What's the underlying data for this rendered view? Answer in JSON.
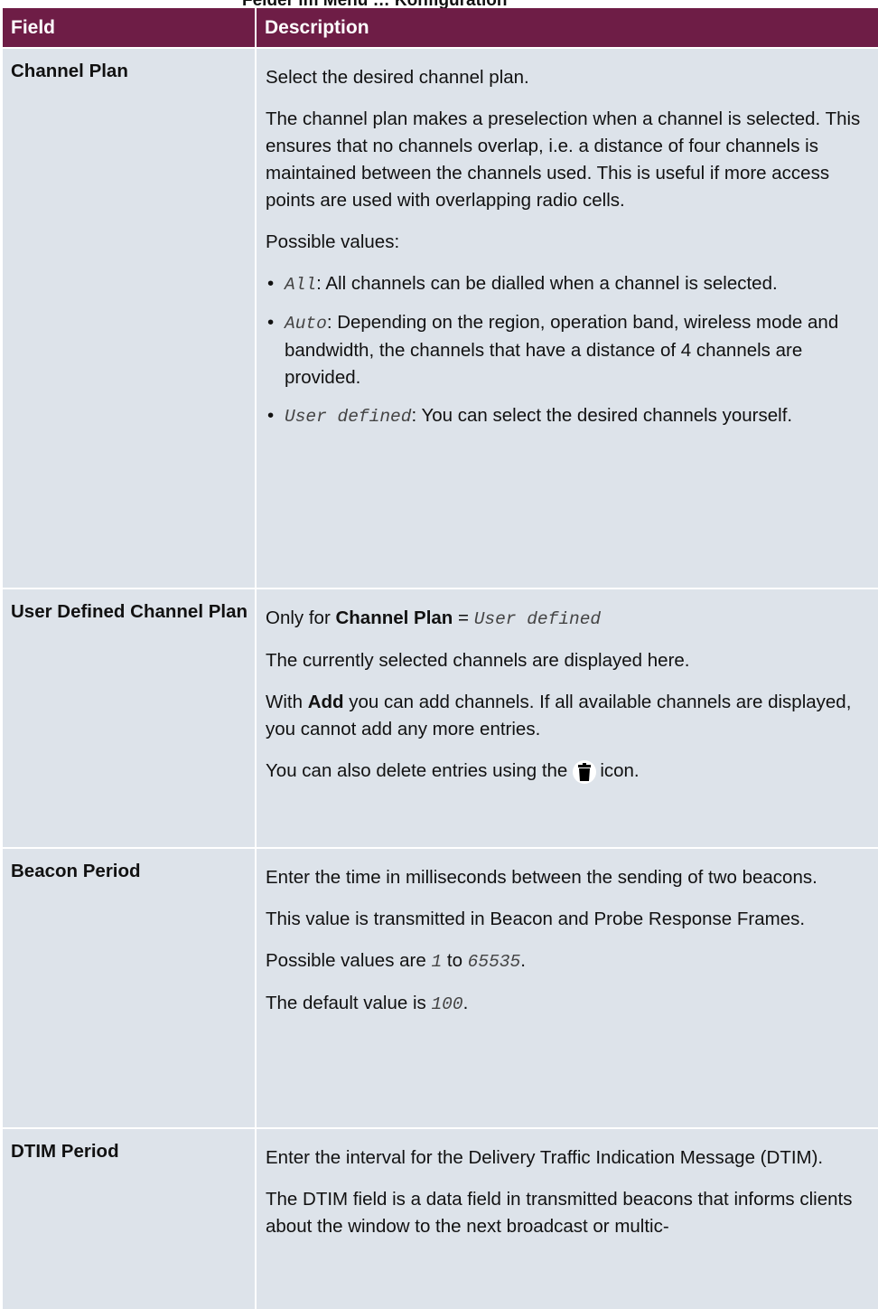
{
  "caption_fragment": "Felder im Menü … Konfiguration",
  "table": {
    "header": {
      "field": "Field",
      "description": "Description"
    },
    "rows": {
      "channel_plan": {
        "field": "Channel Plan",
        "p1": "Select the desired channel plan.",
        "p2": "The channel plan makes a preselection when a channel is se­lected. This ensures that no channels overlap, i.e. a distance of four channels is maintained between the channels used. This is useful if more access points are used with overlapping radio cells.",
        "p3": "Possible values:",
        "b1_code": "All",
        "b1_text": ": All channels can be dialled when a channel is selected.",
        "b2_code": "Auto",
        "b2_text": ": Depending on the region, operation band, wireless mode and bandwidth, the channels that have a distance of 4 channels are provided.",
        "b3_code": "User defined",
        "b3_text": ": You can select the desired channels your­self."
      },
      "user_defined": {
        "field": "User Defined Channel Plan",
        "p1_prefix": "Only for ",
        "p1_bold": "Channel Plan",
        "p1_eq": " = ",
        "p1_code": "User defined",
        "p2": "The currently selected channels are displayed here.",
        "p3_prefix": "With ",
        "p3_bold": "Add",
        "p3_suffix": " you can add channels. If all available channels are displayed, you cannot add any more entries.",
        "p4_prefix": "You can also delete entries using the",
        "p4_suffix": "icon."
      },
      "beacon_period": {
        "field": "Beacon Period",
        "p1": "Enter the time in milliseconds between the sending of two beacons.",
        "p2": "This value is transmitted in Beacon and Probe Response Frames.",
        "p3_prefix": "Possible values are ",
        "p3_code1": "1",
        "p3_mid": " to ",
        "p3_code2": "65535",
        "p3_suffix": ".",
        "p4_prefix": "The default value is ",
        "p4_code": "100",
        "p4_suffix": "."
      },
      "dtim_period": {
        "field": "DTIM Period",
        "p1": "Enter the interval for the Delivery Traffic Indication Message (DTIM).",
        "p2": "The DTIM field is a data field in transmitted beacons that in­forms clients about the window to the next broadcast or multic-"
      }
    }
  },
  "icons": {
    "delete": "trash-icon"
  },
  "colors": {
    "header_bg": "#6e1d46",
    "row_bg": "#dde3ea"
  }
}
